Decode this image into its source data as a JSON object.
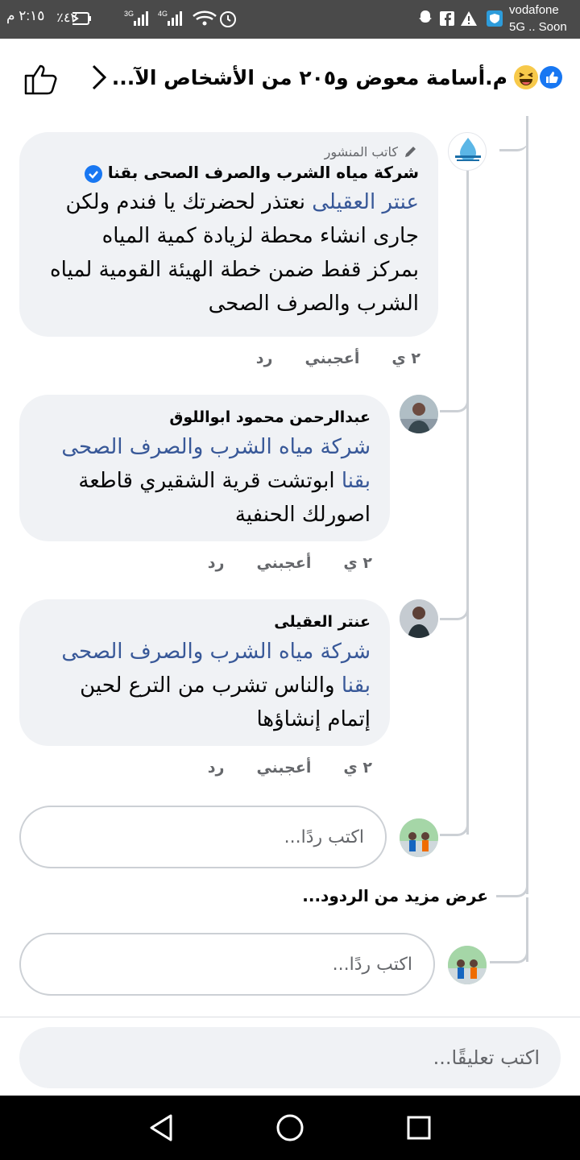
{
  "statusbar": {
    "carrier_line1": "vodafone",
    "carrier_line2": "5G .. Soon",
    "time": "٢:١٥ م",
    "battery": "٤٢٪"
  },
  "header": {
    "title": "م.أسامة معوض و٢٠٥ من الأشخاص الآ..."
  },
  "comments": [
    {
      "badge": "كاتب المنشور",
      "author": "شركة مياه الشرب والصرف الصحى بقنا",
      "lines": [
        {
          "mention": "عنتر العقيلى",
          "text": " نعتذر لحضرتك يا فندم ولكن"
        },
        {
          "mention": "",
          "text": "جارى انشاء محطة لزيادة كمية المياه"
        },
        {
          "mention": "",
          "text": "بمركز قفط ضمن خطة الهيئة القومية لمياه"
        },
        {
          "mention": "",
          "text": "الشرب والصرف الصحى"
        }
      ],
      "time": "٢ ي",
      "like": "أعجبني",
      "reply": "رد"
    },
    {
      "author": "عبدالرحمن محمود ابواللوق",
      "lines": [
        {
          "mention": "شركة مياه الشرب والصرف الصحى",
          "text": ""
        },
        {
          "mention": "بقنا",
          "text": " ابوتشت قرية الشقيري قاطعة"
        },
        {
          "mention": "",
          "text": "اصورلك الحنفية"
        }
      ],
      "time": "٢ ي",
      "like": "أعجبني",
      "reply": "رد"
    },
    {
      "author": "عنتر العقيلى",
      "lines": [
        {
          "mention": "شركة مياه الشرب والصرف الصحى",
          "text": ""
        },
        {
          "mention": "بقنا",
          "text": " والناس تشرب من الترع لحين"
        },
        {
          "mention": "",
          "text": "إتمام إنشاؤها"
        }
      ],
      "time": "٢ ي",
      "like": "أعجبني",
      "reply": "رد"
    }
  ],
  "reply_placeholder": "اكتب ردًا...",
  "more_replies": "عرض مزيد من الردود...",
  "comment_placeholder": "اكتب تعليقًا...",
  "colors": {
    "mention": "#385898",
    "bubble": "#f0f2f5",
    "muted": "#65676b",
    "accent": "#1877f2"
  }
}
